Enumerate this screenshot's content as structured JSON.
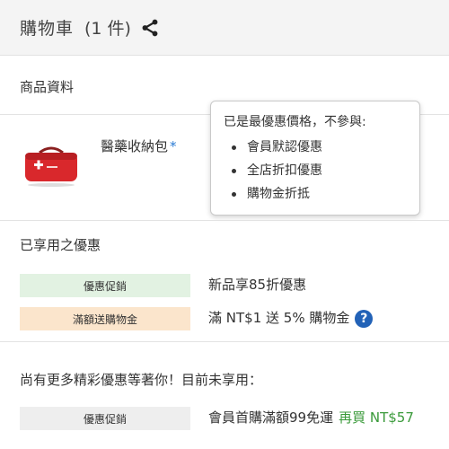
{
  "header": {
    "title": "購物車",
    "count": "(1 件)"
  },
  "product_section": {
    "label": "商品資料",
    "item": {
      "name": "醫藥收納包",
      "star": "*"
    }
  },
  "tooltip": {
    "title": "已是最優惠價格，不參與:",
    "items": [
      "會員默認優惠",
      "全店折扣優惠",
      "購物金折抵"
    ]
  },
  "applied": {
    "label": "已享用之優惠",
    "promos": [
      {
        "badge": "優惠促銷",
        "text": "新品享85折優惠"
      },
      {
        "badge": "滿額送購物金",
        "text": "滿 NT$1 送 5% 購物金"
      }
    ],
    "help_icon": "question-circle-icon"
  },
  "more": {
    "label": "尚有更多精彩優惠等著你！目前未享用：",
    "promo": {
      "badge": "優惠促銷",
      "text": "會員首購滿額99免運",
      "rebuy": "再買 NT$57"
    }
  },
  "colors": {
    "header_bg": "#f4f4f4",
    "badge_green": "#e2f2e2",
    "badge_orange": "#fbe5cc",
    "badge_gray": "#eeeeee",
    "help_blue": "#2262b7",
    "rebuy_green": "#3a9a3a",
    "star_blue": "#2a7bd4"
  }
}
